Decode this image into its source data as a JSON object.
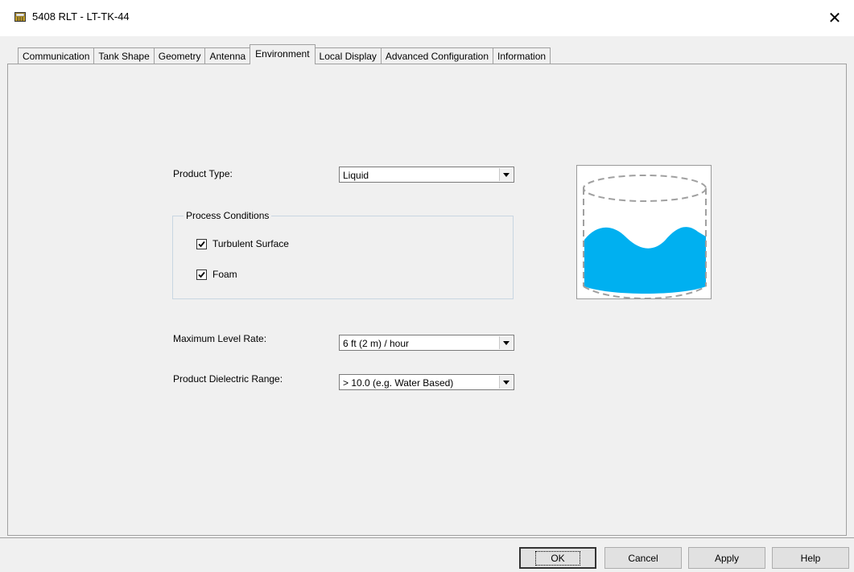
{
  "window": {
    "title": "5408 RLT  - LT-TK-44",
    "icon": "app-device-icon",
    "close_glyph": "✕"
  },
  "tabs": [
    {
      "label": "Communication"
    },
    {
      "label": "Tank Shape"
    },
    {
      "label": "Geometry"
    },
    {
      "label": "Antenna"
    },
    {
      "label": "Environment",
      "active": true
    },
    {
      "label": "Local Display"
    },
    {
      "label": "Advanced Configuration"
    },
    {
      "label": "Information"
    }
  ],
  "form": {
    "product_type_label": "Product Type:",
    "product_type_value": "Liquid",
    "process_conditions_legend": "Process Conditions",
    "turbulent_surface_label": "Turbulent Surface",
    "turbulent_surface_checked": true,
    "foam_label": "Foam",
    "foam_checked": true,
    "max_level_rate_label": "Maximum Level Rate:",
    "max_level_rate_value": "6 ft (2 m) / hour",
    "dielectric_label": "Product Dielectric Range:",
    "dielectric_value": "> 10.0 (e.g. Water Based)"
  },
  "illustration": {
    "name": "tank-liquid-surface",
    "liquid_color": "#00b0f0",
    "outline_color": "#a0a0a0"
  },
  "buttons": {
    "ok": "OK",
    "cancel": "Cancel",
    "apply": "Apply",
    "help": "Help"
  }
}
